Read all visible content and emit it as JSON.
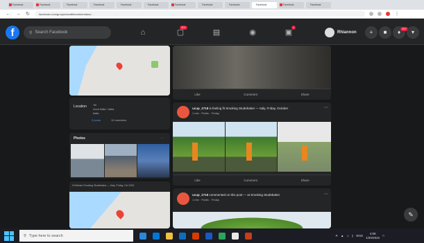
{
  "browser": {
    "tabs": [
      "Facebook",
      "Facebook",
      "Facebook",
      "Facebook",
      "Facebook",
      "Facebook",
      "Facebook",
      "Facebook",
      "Facebook",
      "Facebook",
      "Facebook",
      "Facebook"
    ],
    "url": "facebook.com/groups/seattlemarinersfans/..."
  },
  "header": {
    "search_placeholder": "Search Facebook",
    "home_badge": "",
    "video_badge": "20+",
    "gaming_badge": "1",
    "profile_name": "Rhiannon",
    "messenger_badge": "",
    "notifications_badge": "20+"
  },
  "about": {
    "label": "Location",
    "lines": [
      "Tel",
      "Ivrea Italia / Italia",
      "Italia"
    ],
    "stat1": "3 posts",
    "stat2": "12 members"
  },
  "photos": {
    "title": "Photos",
    "see_all": "..."
  },
  "map2": {
    "caption": "Hi Marisa Smoking Studebaker — Italy, Friday, Oct 2021"
  },
  "post1": {
    "actions": [
      "Like",
      "Comment",
      "Share"
    ]
  },
  "post2": {
    "author": "ucup_2718",
    "title_rest": "is feeling fit Smoking Studebaker — Italy, Friday, October",
    "meta": "1 min · Public · Friday",
    "actions": [
      "Like",
      "Comment",
      "Share"
    ]
  },
  "post3": {
    "author": "ucup_2718",
    "title_rest": "commented on this post — at Smoking Studebaker",
    "meta": "1 min · Public · Friday"
  },
  "taskbar": {
    "search_placeholder": "Type here to search",
    "time": "4:58",
    "date": "1/20/2022"
  }
}
